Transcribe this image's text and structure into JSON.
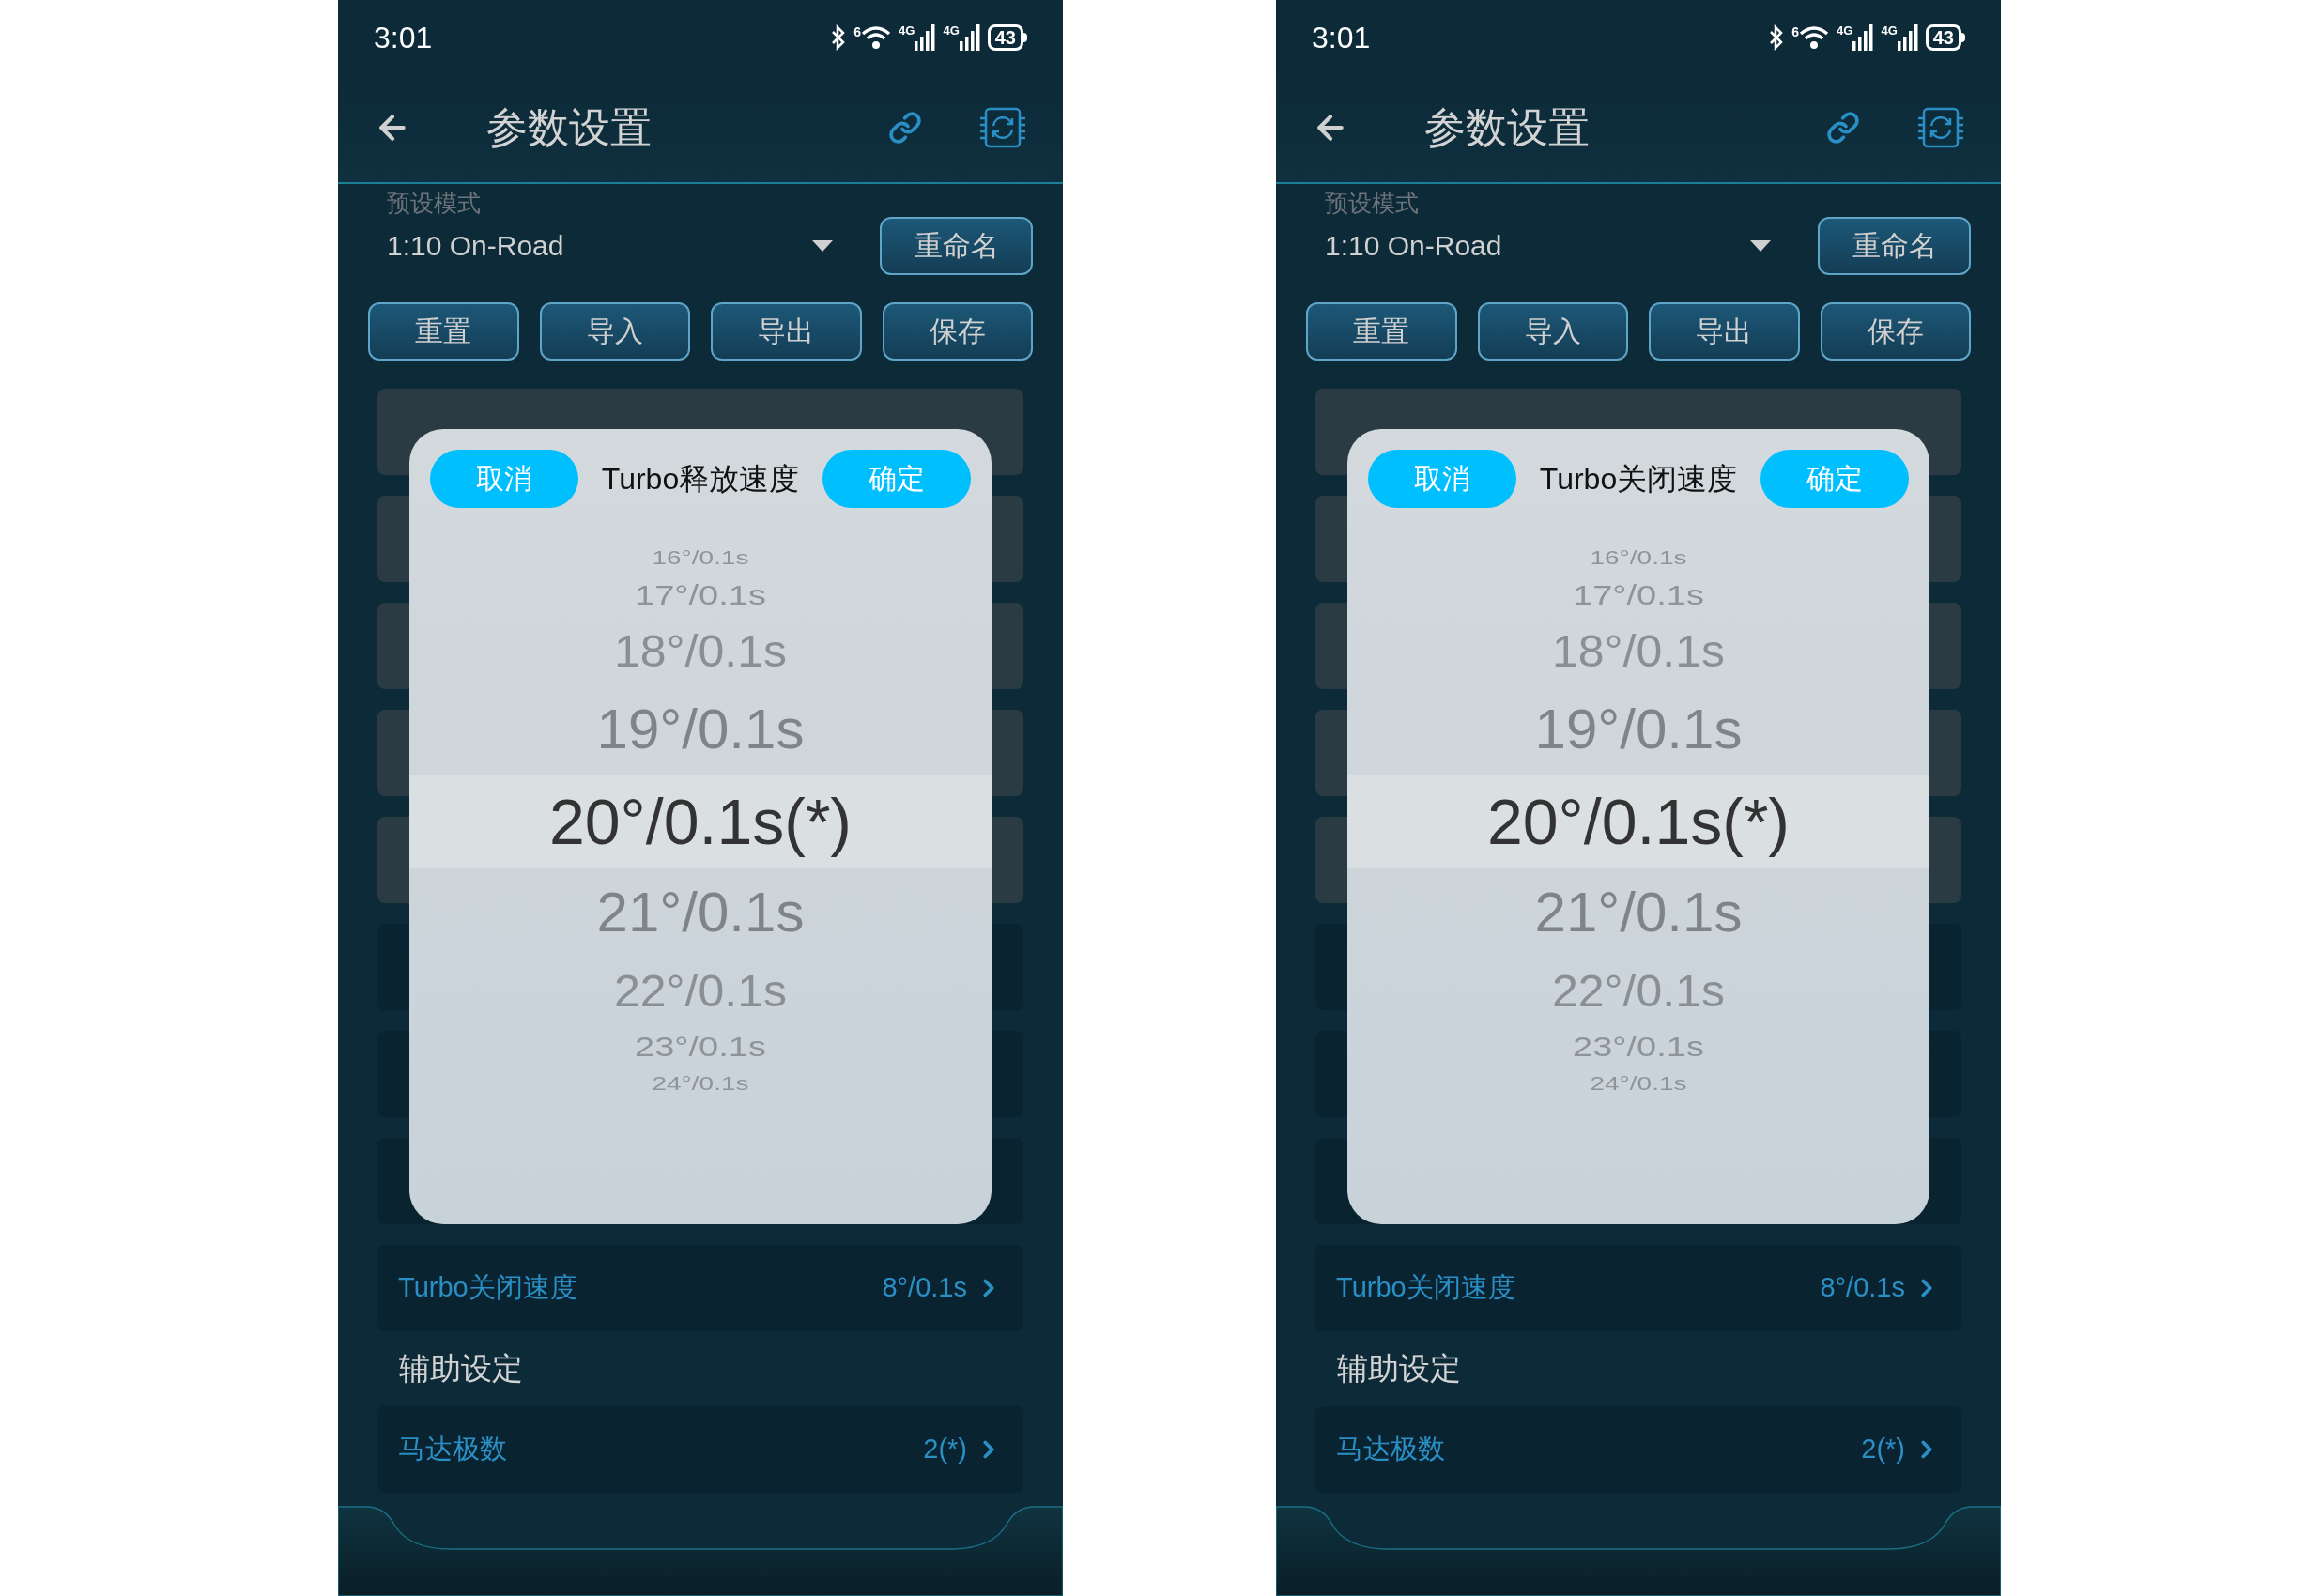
{
  "screens": [
    {
      "status": {
        "time": "3:01",
        "wifi_badge": "6",
        "networks": [
          "4G",
          "4G"
        ],
        "battery": "43"
      },
      "header": {
        "title": "参数设置"
      },
      "preset": {
        "label": "预设模式",
        "value": "1:10 On-Road",
        "rename": "重命名"
      },
      "actions": [
        "重置",
        "导入",
        "导出",
        "保存"
      ],
      "rows": [
        {
          "dimmed": true
        },
        {
          "dimmed": true
        },
        {
          "dimmed": true
        },
        {
          "dimmed": true
        },
        {
          "dimmed": true
        },
        {
          "dimmed": false
        },
        {
          "dimmed": false
        },
        {
          "dimmed": false
        },
        {
          "label": "Turbo关闭速度",
          "value": "8°/0.1s",
          "dimmed": false
        }
      ],
      "section": "辅助设定",
      "rows2": [
        {
          "label": "马达极数",
          "value": "2(*)",
          "dimmed": false
        }
      ],
      "picker": {
        "cancel": "取消",
        "title": "Turbo释放速度",
        "confirm": "确定",
        "options": [
          {
            "label": "16°/0.1s",
            "selected": false
          },
          {
            "label": "17°/0.1s",
            "selected": false
          },
          {
            "label": "18°/0.1s",
            "selected": false
          },
          {
            "label": "19°/0.1s",
            "selected": false
          },
          {
            "label": "20°/0.1s(*)",
            "selected": true
          },
          {
            "label": "21°/0.1s",
            "selected": false
          },
          {
            "label": "22°/0.1s",
            "selected": false
          },
          {
            "label": "23°/0.1s",
            "selected": false
          },
          {
            "label": "24°/0.1s",
            "selected": false
          }
        ]
      }
    },
    {
      "status": {
        "time": "3:01",
        "wifi_badge": "6",
        "networks": [
          "4G",
          "4G"
        ],
        "battery": "43"
      },
      "header": {
        "title": "参数设置"
      },
      "preset": {
        "label": "预设模式",
        "value": "1:10 On-Road",
        "rename": "重命名"
      },
      "actions": [
        "重置",
        "导入",
        "导出",
        "保存"
      ],
      "rows": [
        {
          "dimmed": true
        },
        {
          "dimmed": true
        },
        {
          "dimmed": true
        },
        {
          "dimmed": true
        },
        {
          "dimmed": true
        },
        {
          "dimmed": false
        },
        {
          "dimmed": false
        },
        {
          "dimmed": false
        },
        {
          "label": "Turbo关闭速度",
          "value": "8°/0.1s",
          "dimmed": false
        }
      ],
      "section": "辅助设定",
      "rows2": [
        {
          "label": "马达极数",
          "value": "2(*)",
          "dimmed": false
        }
      ],
      "picker": {
        "cancel": "取消",
        "title": "Turbo关闭速度",
        "confirm": "确定",
        "options": [
          {
            "label": "16°/0.1s",
            "selected": false
          },
          {
            "label": "17°/0.1s",
            "selected": false
          },
          {
            "label": "18°/0.1s",
            "selected": false
          },
          {
            "label": "19°/0.1s",
            "selected": false
          },
          {
            "label": "20°/0.1s(*)",
            "selected": true
          },
          {
            "label": "21°/0.1s",
            "selected": false
          },
          {
            "label": "22°/0.1s",
            "selected": false
          },
          {
            "label": "23°/0.1s",
            "selected": false
          },
          {
            "label": "24°/0.1s",
            "selected": false
          }
        ]
      }
    }
  ]
}
